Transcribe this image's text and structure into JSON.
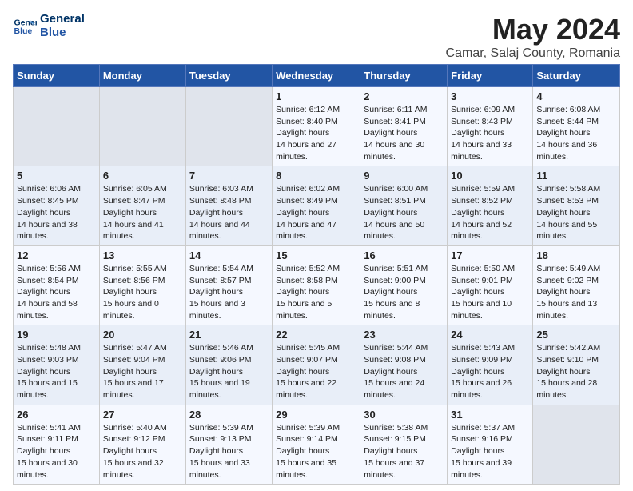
{
  "header": {
    "logo_line1": "General",
    "logo_line2": "Blue",
    "title": "May 2024",
    "subtitle": "Camar, Salaj County, Romania"
  },
  "weekdays": [
    "Sunday",
    "Monday",
    "Tuesday",
    "Wednesday",
    "Thursday",
    "Friday",
    "Saturday"
  ],
  "weeks": [
    [
      {
        "day": "",
        "empty": true
      },
      {
        "day": "",
        "empty": true
      },
      {
        "day": "",
        "empty": true
      },
      {
        "day": "1",
        "sunrise": "6:12 AM",
        "sunset": "8:40 PM",
        "daylight": "14 hours and 27 minutes."
      },
      {
        "day": "2",
        "sunrise": "6:11 AM",
        "sunset": "8:41 PM",
        "daylight": "14 hours and 30 minutes."
      },
      {
        "day": "3",
        "sunrise": "6:09 AM",
        "sunset": "8:43 PM",
        "daylight": "14 hours and 33 minutes."
      },
      {
        "day": "4",
        "sunrise": "6:08 AM",
        "sunset": "8:44 PM",
        "daylight": "14 hours and 36 minutes."
      }
    ],
    [
      {
        "day": "5",
        "sunrise": "6:06 AM",
        "sunset": "8:45 PM",
        "daylight": "14 hours and 38 minutes."
      },
      {
        "day": "6",
        "sunrise": "6:05 AM",
        "sunset": "8:47 PM",
        "daylight": "14 hours and 41 minutes."
      },
      {
        "day": "7",
        "sunrise": "6:03 AM",
        "sunset": "8:48 PM",
        "daylight": "14 hours and 44 minutes."
      },
      {
        "day": "8",
        "sunrise": "6:02 AM",
        "sunset": "8:49 PM",
        "daylight": "14 hours and 47 minutes."
      },
      {
        "day": "9",
        "sunrise": "6:00 AM",
        "sunset": "8:51 PM",
        "daylight": "14 hours and 50 minutes."
      },
      {
        "day": "10",
        "sunrise": "5:59 AM",
        "sunset": "8:52 PM",
        "daylight": "14 hours and 52 minutes."
      },
      {
        "day": "11",
        "sunrise": "5:58 AM",
        "sunset": "8:53 PM",
        "daylight": "14 hours and 55 minutes."
      }
    ],
    [
      {
        "day": "12",
        "sunrise": "5:56 AM",
        "sunset": "8:54 PM",
        "daylight": "14 hours and 58 minutes."
      },
      {
        "day": "13",
        "sunrise": "5:55 AM",
        "sunset": "8:56 PM",
        "daylight": "15 hours and 0 minutes."
      },
      {
        "day": "14",
        "sunrise": "5:54 AM",
        "sunset": "8:57 PM",
        "daylight": "15 hours and 3 minutes."
      },
      {
        "day": "15",
        "sunrise": "5:52 AM",
        "sunset": "8:58 PM",
        "daylight": "15 hours and 5 minutes."
      },
      {
        "day": "16",
        "sunrise": "5:51 AM",
        "sunset": "9:00 PM",
        "daylight": "15 hours and 8 minutes."
      },
      {
        "day": "17",
        "sunrise": "5:50 AM",
        "sunset": "9:01 PM",
        "daylight": "15 hours and 10 minutes."
      },
      {
        "day": "18",
        "sunrise": "5:49 AM",
        "sunset": "9:02 PM",
        "daylight": "15 hours and 13 minutes."
      }
    ],
    [
      {
        "day": "19",
        "sunrise": "5:48 AM",
        "sunset": "9:03 PM",
        "daylight": "15 hours and 15 minutes."
      },
      {
        "day": "20",
        "sunrise": "5:47 AM",
        "sunset": "9:04 PM",
        "daylight": "15 hours and 17 minutes."
      },
      {
        "day": "21",
        "sunrise": "5:46 AM",
        "sunset": "9:06 PM",
        "daylight": "15 hours and 19 minutes."
      },
      {
        "day": "22",
        "sunrise": "5:45 AM",
        "sunset": "9:07 PM",
        "daylight": "15 hours and 22 minutes."
      },
      {
        "day": "23",
        "sunrise": "5:44 AM",
        "sunset": "9:08 PM",
        "daylight": "15 hours and 24 minutes."
      },
      {
        "day": "24",
        "sunrise": "5:43 AM",
        "sunset": "9:09 PM",
        "daylight": "15 hours and 26 minutes."
      },
      {
        "day": "25",
        "sunrise": "5:42 AM",
        "sunset": "9:10 PM",
        "daylight": "15 hours and 28 minutes."
      }
    ],
    [
      {
        "day": "26",
        "sunrise": "5:41 AM",
        "sunset": "9:11 PM",
        "daylight": "15 hours and 30 minutes."
      },
      {
        "day": "27",
        "sunrise": "5:40 AM",
        "sunset": "9:12 PM",
        "daylight": "15 hours and 32 minutes."
      },
      {
        "day": "28",
        "sunrise": "5:39 AM",
        "sunset": "9:13 PM",
        "daylight": "15 hours and 33 minutes."
      },
      {
        "day": "29",
        "sunrise": "5:39 AM",
        "sunset": "9:14 PM",
        "daylight": "15 hours and 35 minutes."
      },
      {
        "day": "30",
        "sunrise": "5:38 AM",
        "sunset": "9:15 PM",
        "daylight": "15 hours and 37 minutes."
      },
      {
        "day": "31",
        "sunrise": "5:37 AM",
        "sunset": "9:16 PM",
        "daylight": "15 hours and 39 minutes."
      },
      {
        "day": "",
        "empty": true
      }
    ]
  ],
  "labels": {
    "sunrise": "Sunrise:",
    "sunset": "Sunset:",
    "daylight": "Daylight hours"
  }
}
